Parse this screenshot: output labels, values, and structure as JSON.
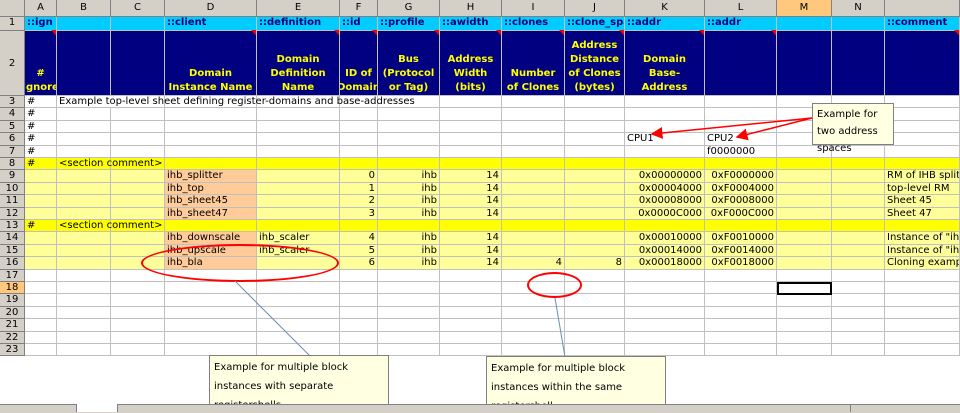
{
  "columns": [
    "A",
    "B",
    "C",
    "D",
    "E",
    "F",
    "G",
    "H",
    "I",
    "J",
    "K",
    "L",
    "M",
    "N",
    ""
  ],
  "selected_column": "M",
  "rows": [
    "1",
    "2",
    "3",
    "4",
    "5",
    "6",
    "7",
    "8",
    "9",
    "10",
    "11",
    "12",
    "13",
    "14",
    "15",
    "16",
    "17",
    "18",
    "19",
    "20",
    "21",
    "22",
    "23"
  ],
  "selected_row": "18",
  "header_row1": {
    "A": "::ign",
    "D": "::client",
    "E": "::definition",
    "F": "::id",
    "G": "::profile",
    "H": "::awidth",
    "I": "::clones",
    "J": "::clone_spacing",
    "K": "::addr",
    "L": "::addr",
    "O": "::comment"
  },
  "header_row2": {
    "A": "# Ignore",
    "D": "Domain Instance Name",
    "E": "Domain Definition Name",
    "F": "ID of Domain",
    "G": "Bus (Protocol or Tag)",
    "H": "Address Width (bits)",
    "I": "Number of Clones",
    "J": "Address Distance of Clones (bytes)",
    "K": "Domain Base-Address",
    "L": "",
    "O": ""
  },
  "cells": {
    "3": {
      "A": "#",
      "B": "Example top-level sheet defining register-domains and base-addresses"
    },
    "4": {
      "A": "#"
    },
    "5": {
      "A": "#"
    },
    "6": {
      "A": "#",
      "K": "CPU1",
      "L": "CPU2"
    },
    "7": {
      "A": "#",
      "L": "f0000000"
    },
    "8": {
      "A": "#",
      "B": "<section comment>"
    },
    "9": {
      "D": "ihb_splitter",
      "F": "0",
      "G": "ihb",
      "H": "14",
      "K": "0x00000000",
      "L": "0xF0000000",
      "O": "RM of IHB splitter"
    },
    "10": {
      "D": "ihb_top",
      "F": "1",
      "G": "ihb",
      "H": "14",
      "K": "0x00004000",
      "L": "0xF0004000",
      "O": "top-level RM"
    },
    "11": {
      "D": "ihb_sheet45",
      "F": "2",
      "G": "ihb",
      "H": "14",
      "K": "0x00008000",
      "L": "0xF0008000",
      "O": "Sheet 45"
    },
    "12": {
      "D": "ihb_sheet47",
      "F": "3",
      "G": "ihb",
      "H": "14",
      "K": "0x0000C000",
      "L": "0xF000C000",
      "O": "Sheet 47"
    },
    "13": {
      "A": "#",
      "B": "<section comment>"
    },
    "14": {
      "D": "ihb_downscale",
      "E": "ihb_scaler",
      "F": "4",
      "G": "ihb",
      "H": "14",
      "K": "0x00010000",
      "L": "0xF0010000",
      "O": "Instance of \"ihb_scaler\""
    },
    "15": {
      "D": "ihb_upscale",
      "E": "ihb_scaler",
      "F": "5",
      "G": "ihb",
      "H": "14",
      "K": "0x00014000",
      "L": "0xF0014000",
      "O": "Instance of \"ihb_scaler\""
    },
    "16": {
      "D": "ihb_bla",
      "F": "6",
      "G": "ihb",
      "H": "14",
      "I": "4",
      "J": "8",
      "K": "0x00018000",
      "L": "0xF0018000",
      "O": "Cloning example"
    }
  },
  "notes": {
    "two_spaces": "Example for two address spaces",
    "multi_block": "Example for multiple block instances with separate registershells",
    "multi_clone": "Example for multiple block instances within the same registershell"
  },
  "colors": {
    "header_cyan": "#00ccff",
    "header_navy": "#000080",
    "header_text": "#ffff00",
    "row_yellow": "#ffff99",
    "section_yellow": "#ffff00",
    "instance_peach": "#ffcc99",
    "annotation_red": "#ff0000"
  }
}
